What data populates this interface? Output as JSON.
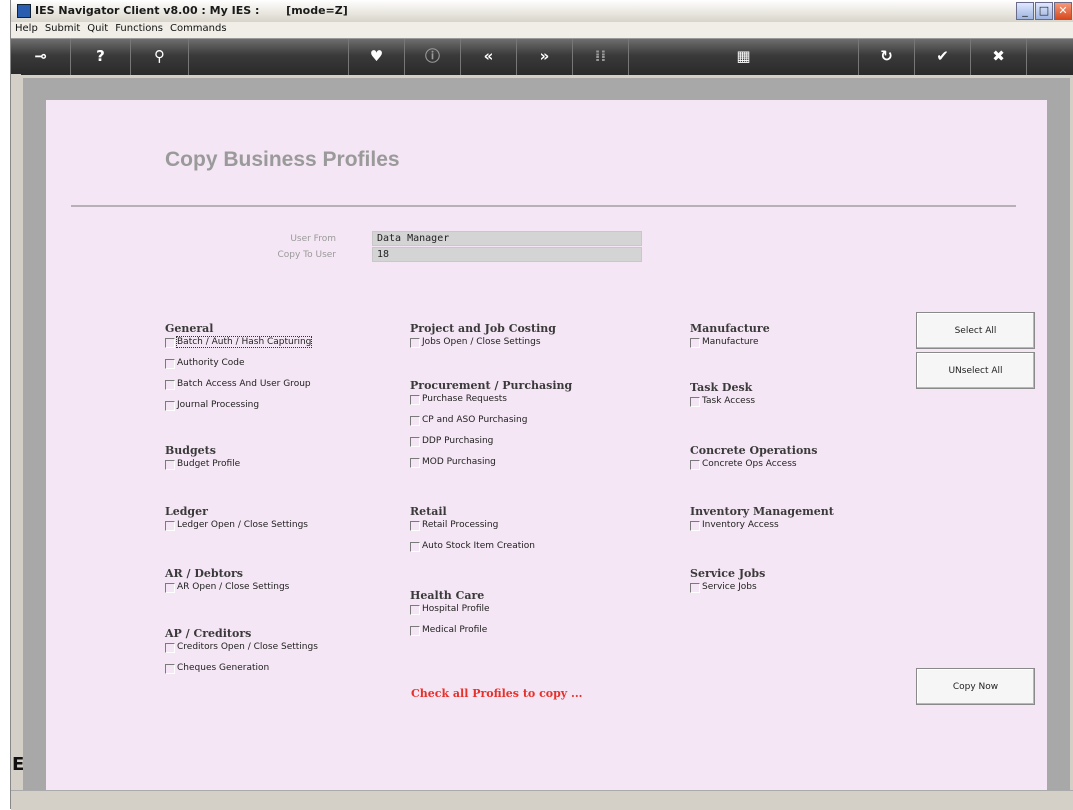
{
  "window": {
    "title": "IES Navigator Client v8.00 : My IES :       [mode=Z]",
    "buttons": [
      "minimize",
      "maximize",
      "close"
    ]
  },
  "menu": [
    "Help",
    "Submit",
    "Quit",
    "Functions",
    "Commands"
  ],
  "toolbar": [
    {
      "name": "key-icon",
      "glyph": "⊸"
    },
    {
      "name": "help-icon",
      "glyph": "?"
    },
    {
      "name": "search-icon",
      "glyph": "⚲"
    },
    {
      "name": "heart-icon",
      "glyph": "♥"
    },
    {
      "name": "info-icon",
      "glyph": "ⓘ"
    },
    {
      "name": "back-icon",
      "glyph": "«"
    },
    {
      "name": "forward-icon",
      "glyph": "»"
    },
    {
      "name": "grid-icon",
      "glyph": "⁞⁞"
    },
    {
      "name": "print-icon",
      "glyph": "▦"
    },
    {
      "name": "refresh-icon",
      "glyph": "↻"
    },
    {
      "name": "ok-icon",
      "glyph": "✔"
    },
    {
      "name": "cancel-icon",
      "glyph": "✖"
    }
  ],
  "page": {
    "title": "Copy Business Profiles",
    "user_from_label": "User From",
    "user_from_value": "Data Manager",
    "copy_to_label": "Copy To User",
    "copy_to_value": "18",
    "hint": "Check all Profiles to copy ..."
  },
  "sections": [
    {
      "title": "General",
      "items": [
        "Batch / Auth / Hash Capturing",
        "Authority Code",
        "Batch Access And User Group",
        "Journal Processing"
      ]
    },
    {
      "title": "Budgets",
      "items": [
        "Budget Profile"
      ]
    },
    {
      "title": "Ledger",
      "items": [
        "Ledger Open / Close Settings"
      ]
    },
    {
      "title": "AR / Debtors",
      "items": [
        "AR Open / Close Settings"
      ]
    },
    {
      "title": "AP / Creditors",
      "items": [
        "Creditors Open / Close Settings",
        "Cheques Generation"
      ]
    },
    {
      "title": "Project and Job Costing",
      "items": [
        "Jobs Open / Close Settings"
      ]
    },
    {
      "title": "Procurement / Purchasing",
      "items": [
        "Purchase Requests",
        "CP and ASO Purchasing",
        "DDP Purchasing",
        "MOD Purchasing"
      ]
    },
    {
      "title": "Retail",
      "items": [
        "Retail Processing",
        "Auto Stock Item Creation"
      ]
    },
    {
      "title": "Health Care",
      "items": [
        "Hospital Profile",
        "Medical Profile"
      ]
    },
    {
      "title": "Manufacture",
      "items": [
        "Manufacture"
      ]
    },
    {
      "title": "Task Desk",
      "items": [
        "Task Access"
      ]
    },
    {
      "title": "Concrete Operations",
      "items": [
        "Concrete Ops Access"
      ]
    },
    {
      "title": "Inventory Management",
      "items": [
        "Inventory Access"
      ]
    },
    {
      "title": "Service Jobs",
      "items": [
        "Service Jobs"
      ]
    }
  ],
  "buttons": {
    "select_all": "Select All",
    "unselect_all": "UNselect All",
    "copy_now": "Copy Now"
  }
}
